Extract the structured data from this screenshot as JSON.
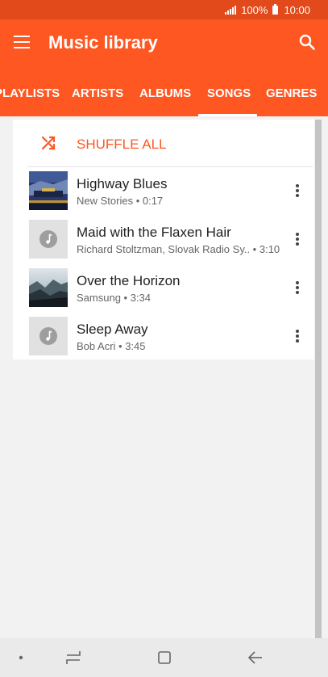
{
  "status_bar": {
    "battery": "100%",
    "time": "10:00"
  },
  "app_bar": {
    "title": "Music library"
  },
  "tabs": [
    {
      "label": "PLAYLISTS"
    },
    {
      "label": "ARTISTS"
    },
    {
      "label": "ALBUMS"
    },
    {
      "label": "SONGS",
      "selected": true
    },
    {
      "label": "GENRES"
    }
  ],
  "shuffle": {
    "label": "SHUFFLE ALL"
  },
  "songs": [
    {
      "title": "Highway Blues",
      "meta": "New Stories • 0:17",
      "art": "album-cover"
    },
    {
      "title": "Maid with the Flaxen Hair",
      "meta": "Richard Stoltzman, Slovak Radio Sy..  • 3:10",
      "art": "music-note-placeholder"
    },
    {
      "title": "Over the Horizon",
      "meta": "Samsung • 3:34",
      "art": "album-cover"
    },
    {
      "title": "Sleep Away",
      "meta": "Bob Acri • 3:45",
      "art": "music-note-placeholder"
    }
  ],
  "colors": {
    "accent": "#fe5722",
    "status_bar": "#e2491b",
    "background": "#f2f2f2"
  }
}
